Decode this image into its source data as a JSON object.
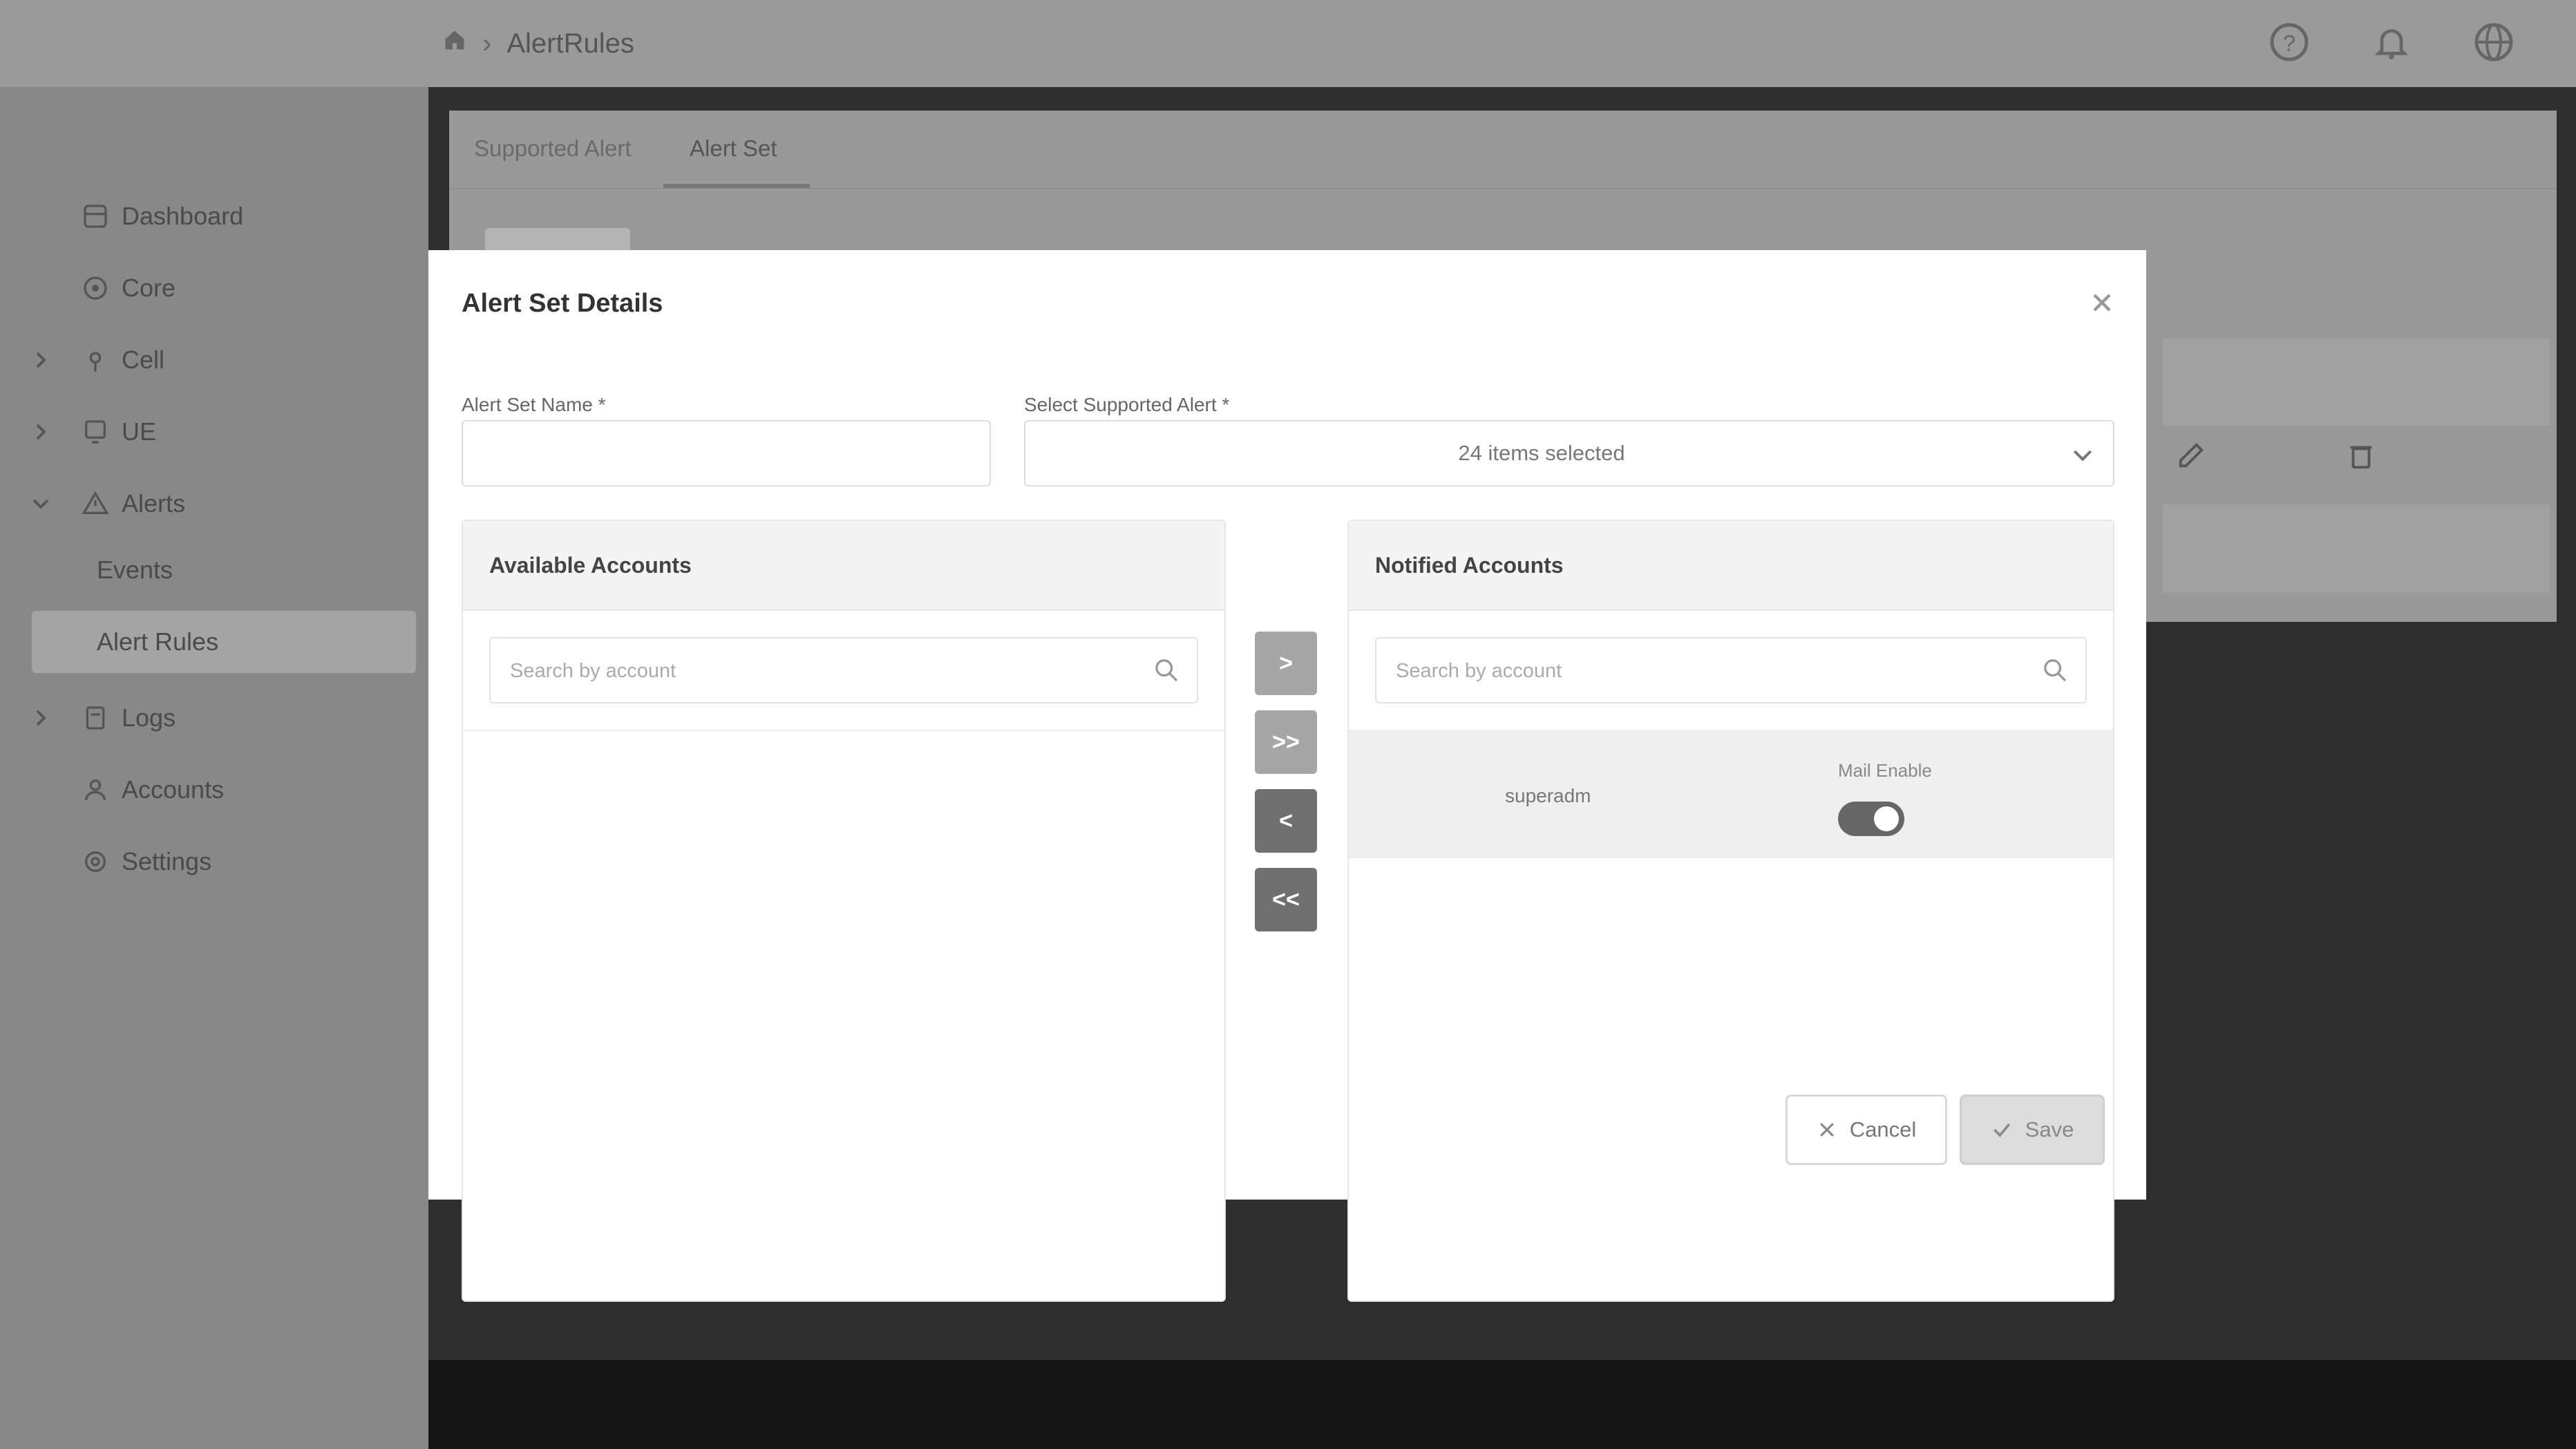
{
  "header": {
    "breadcrumb": [
      "AlertRules"
    ],
    "icons": [
      "home-icon",
      "help-icon",
      "bell-icon",
      "globe-icon"
    ]
  },
  "sidebar": {
    "items": [
      {
        "label": "Dashboard",
        "icon": "dashboard-icon",
        "expandable": false
      },
      {
        "label": "Core",
        "icon": "core-icon",
        "expandable": false
      },
      {
        "label": "Cell",
        "icon": "cell-icon",
        "expandable": true
      },
      {
        "label": "UE",
        "icon": "ue-icon",
        "expandable": true
      },
      {
        "label": "Alerts",
        "icon": "alert-icon",
        "expandable": true,
        "expanded": true
      },
      {
        "label": "Events",
        "sub": true
      },
      {
        "label": "Alert Rules",
        "sub": true,
        "active": true
      },
      {
        "label": "Logs",
        "icon": "logs-icon",
        "expandable": true
      },
      {
        "label": "Accounts",
        "icon": "accounts-icon",
        "expandable": false
      },
      {
        "label": "Settings",
        "icon": "settings-icon",
        "expandable": false
      }
    ]
  },
  "background": {
    "tabs": [
      "Supported Alert",
      "Alert Set"
    ],
    "active_tab": "Alert Set"
  },
  "modal": {
    "title": "Alert Set Details",
    "alert_set_name_label": "Alert Set Name *",
    "alert_set_name_value": "",
    "supported_alert_label": "Select Supported Alert *",
    "supported_alert_value": "24 items selected",
    "available": {
      "title": "Available Accounts",
      "search_placeholder": "Search by account",
      "accounts": []
    },
    "notified": {
      "title": "Notified Accounts",
      "search_placeholder": "Search by account",
      "accounts": [
        {
          "name": "superadm",
          "mail_label": "Mail Enable",
          "mail_enabled": true
        }
      ]
    },
    "transfer_buttons": [
      {
        "label": ">",
        "enabled": false
      },
      {
        "label": ">>",
        "enabled": false
      },
      {
        "label": "<",
        "enabled": true
      },
      {
        "label": "<<",
        "enabled": true
      }
    ],
    "cancel_label": "Cancel",
    "save_label": "Save"
  },
  "colors": {
    "overlay_bg": "#2e2e2e",
    "sidebar_bg": "#888888",
    "header_bg": "#9a9a9a",
    "transfer_disabled": "#a6a6a6",
    "transfer_enabled": "#707070",
    "toggle_on": "#666666"
  }
}
